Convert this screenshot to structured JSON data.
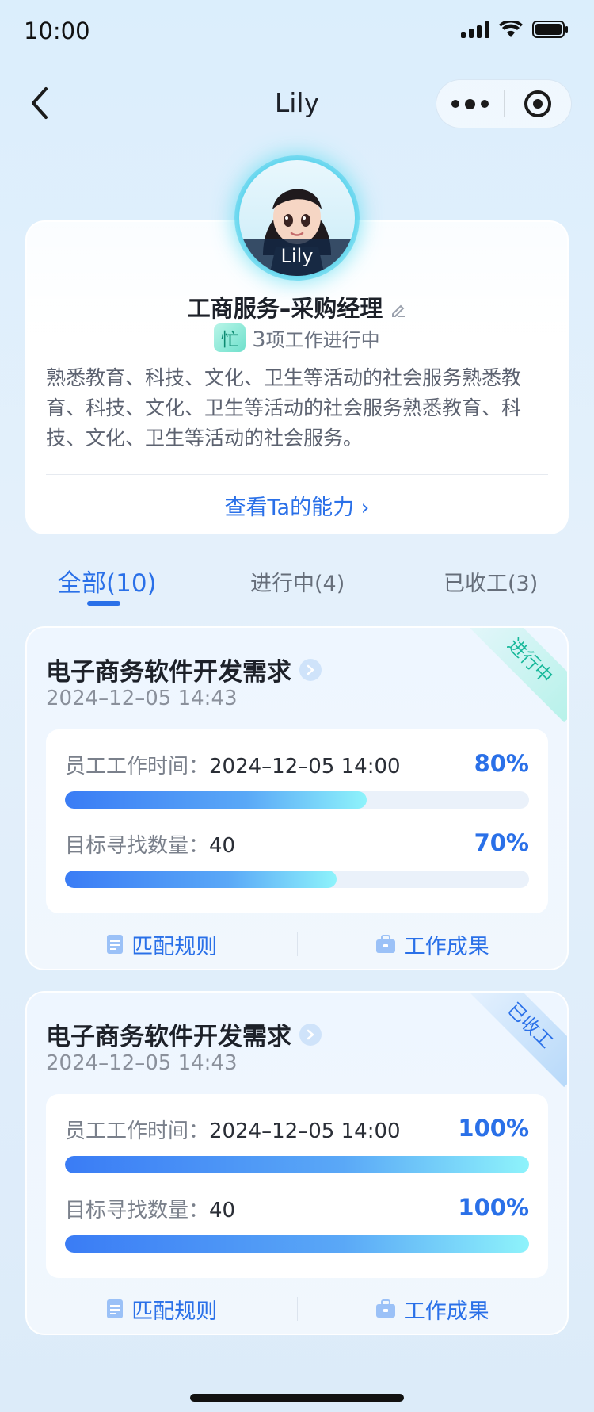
{
  "status_bar": {
    "time": "10:00"
  },
  "nav": {
    "title": "Lily"
  },
  "profile": {
    "avatar_name": "Lily",
    "role": "工商服务–采购经理",
    "busy_badge": "忙",
    "busy_count": "3",
    "busy_text": "项工作进行中",
    "description": "熟悉教育、科技、文化、卫生等活动的社会服务熟悉教育、科技、文化、卫生等活动的社会服务熟悉教育、科技、文化、卫生等活动的社会服务。",
    "ability_link": "查看Ta的能力 ›"
  },
  "tabs": [
    {
      "label": "全部(10)",
      "active": true
    },
    {
      "label": "进行中(4)",
      "active": false
    },
    {
      "label": "已收工(3)",
      "active": false
    }
  ],
  "tasks": [
    {
      "title": "电子商务软件开发需求",
      "date": "2024–12–05 14:43",
      "status": "进行中",
      "rows": [
        {
          "label": "员工工作时间：",
          "value": "2024–12–05 14:00",
          "percent_text": "80%",
          "progress": 0.65
        },
        {
          "label": "目标寻找数量：",
          "value": "40",
          "percent_text": "70%",
          "progress": 0.585
        }
      ],
      "actions": [
        "匹配规则",
        "工作成果"
      ]
    },
    {
      "title": "电子商务软件开发需求",
      "date": "2024–12–05 14:43",
      "status": "已收工",
      "rows": [
        {
          "label": "员工工作时间：",
          "value": "2024–12–05 14:00",
          "percent_text": "100%",
          "progress": 1.0
        },
        {
          "label": "目标寻找数量：",
          "value": "40",
          "percent_text": "100%",
          "progress": 1.0
        }
      ],
      "actions": [
        "匹配规则",
        "工作成果"
      ]
    }
  ],
  "colors": {
    "accent": "#2a70e8",
    "active_status": "#17b89a",
    "busy_badge": "#6fe0cc"
  }
}
